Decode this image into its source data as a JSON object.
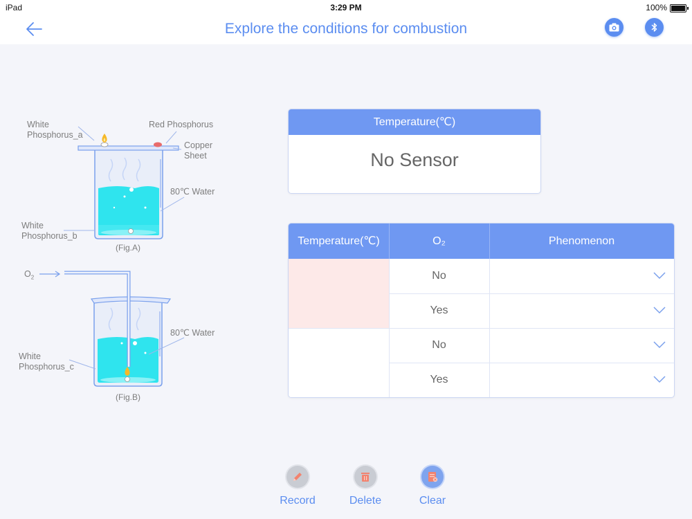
{
  "status_bar": {
    "carrier": "iPad",
    "time": "3:29 PM",
    "battery": "100%"
  },
  "nav": {
    "title": "Explore the conditions for combustion"
  },
  "illustration": {
    "labels": {
      "white_phosphorus_a": [
        "White",
        "Phosphorus_a"
      ],
      "red_phosphorus": "Red Phosphorus",
      "copper_sheet": [
        "Copper",
        "Sheet"
      ],
      "water_a": "80℃ Water",
      "white_phosphorus_b": [
        "White",
        "Phosphorus_b"
      ],
      "fig_a": "(Fig.A)",
      "o2": "O",
      "o2_sub": "2",
      "water_b": "80℃ Water",
      "white_phosphorus_c": [
        "White",
        "Phosphorus_c"
      ],
      "fig_b": "(Fig.B)"
    }
  },
  "temperature_card": {
    "header": "Temperature(℃)",
    "value": "No Sensor"
  },
  "table": {
    "headers": {
      "temperature": "Temperature(℃)",
      "o2": "O₂",
      "phenomenon": "Phenomenon"
    },
    "rows": [
      {
        "o2": "No",
        "phenomenon": ""
      },
      {
        "o2": "Yes",
        "phenomenon": ""
      },
      {
        "o2": "No",
        "phenomenon": ""
      },
      {
        "o2": "Yes",
        "phenomenon": ""
      }
    ],
    "groups": [
      {
        "temperature": "",
        "highlight": "#fde9e8"
      },
      {
        "temperature": "",
        "highlight": "#ffffff"
      }
    ]
  },
  "toolbar": {
    "record": "Record",
    "delete": "Delete",
    "clear": "Clear"
  },
  "colors": {
    "accent": "#5b8df0",
    "header": "#6f98f2",
    "water": "#2fe4ee",
    "record": "#f2836f"
  }
}
